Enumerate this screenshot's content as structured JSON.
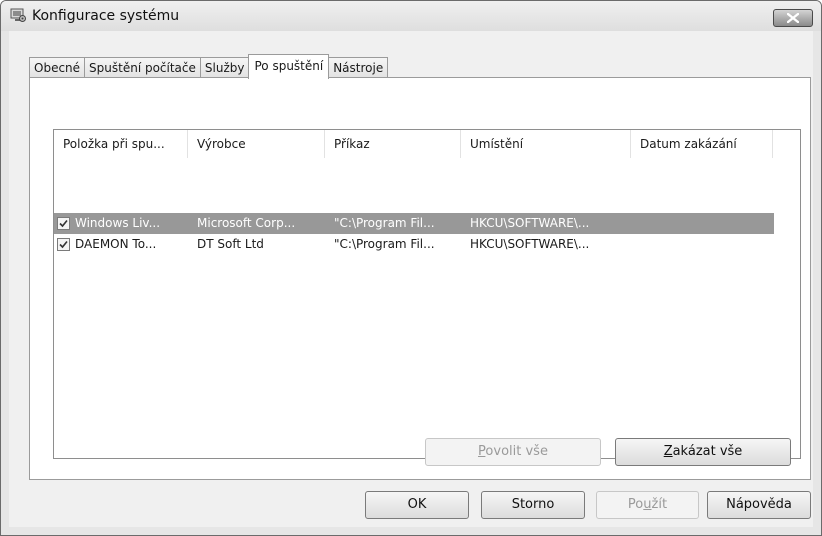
{
  "window": {
    "title": "Konfigurace systému"
  },
  "tabs": [
    {
      "label": "Obecné"
    },
    {
      "label": "Spuštění počítače"
    },
    {
      "label": "Služby"
    },
    {
      "label": "Po spuštění",
      "active": true
    },
    {
      "label": "Nástroje"
    }
  ],
  "list": {
    "columns": [
      "Položka při spu...",
      "Výrobce",
      "Příkaz",
      "Umístění",
      "Datum zakázání"
    ],
    "rows": [
      {
        "checked": true,
        "item": "Windows Liv...",
        "vendor": "Microsoft Corp...",
        "command": "\"C:\\Program Fil...",
        "location": "HKCU\\SOFTWARE\\...",
        "date": "",
        "selected": true
      },
      {
        "checked": true,
        "item": "DAEMON To...",
        "vendor": "DT Soft Ltd",
        "command": "\"C:\\Program Fil...",
        "location": "HKCU\\SOFTWARE\\...",
        "date": "",
        "selected": false
      }
    ]
  },
  "panel_buttons": {
    "enable_all_access": "P",
    "enable_all_rest": "ovolit vše",
    "disable_all_access": "Z",
    "disable_all_rest": "akázat vše"
  },
  "dialog_buttons": {
    "ok": "OK",
    "cancel": "Storno",
    "apply_pre": "Po",
    "apply_access": "u",
    "apply_post": "žít",
    "help": "Nápověda"
  },
  "colors": {
    "selection": "#989898",
    "window_bg": "#f0f0f0",
    "close_button": "#8a8a8a"
  },
  "icons": {
    "title": "computer-settings-icon",
    "close": "close-icon",
    "checkbox": "checkmark-icon"
  }
}
